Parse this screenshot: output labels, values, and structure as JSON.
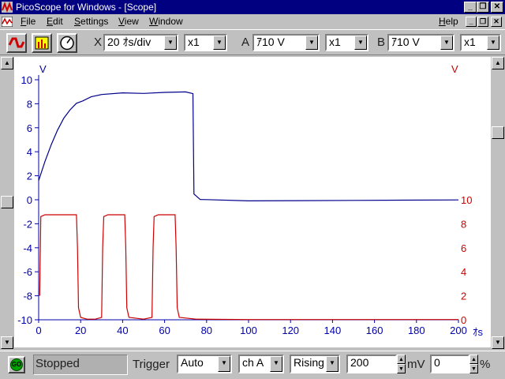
{
  "window": {
    "title": "PicoScope for Windows - [Scope]",
    "minimize": "_",
    "restore": "❐",
    "close": "✕"
  },
  "menu": {
    "items": [
      {
        "underline": "F",
        "rest": "ile"
      },
      {
        "underline": "E",
        "rest": "dit"
      },
      {
        "underline": "S",
        "rest": "ettings"
      },
      {
        "underline": "V",
        "rest": "iew"
      },
      {
        "underline": "W",
        "rest": "indow"
      }
    ],
    "help": {
      "underline": "H",
      "rest": "elp"
    }
  },
  "toolbar": {
    "x_label": "X",
    "timebase": "20 ｵs/div",
    "x_multiplier": "x1",
    "a_label": "A",
    "a_range": "ｱ10 V",
    "a_multiplier": "x1",
    "b_label": "B",
    "b_range": "ｱ10 V",
    "b_multiplier": "x1"
  },
  "icons": {
    "app": "picoscope-icon",
    "signal": "red-waveform-icon",
    "spectrum": "spectrum-icon",
    "meter": "meter-icon"
  },
  "colors": {
    "channel_a": "#00008b",
    "channel_b": "#cc0000",
    "axis": "#0000aa"
  },
  "status": {
    "go": "GO",
    "state": "Stopped",
    "trigger_label": "Trigger",
    "trigger_mode": "Auto",
    "trigger_channel": "ch A",
    "trigger_edge": "Rising",
    "trigger_level": "200",
    "trigger_unit": "mV",
    "delay": "0",
    "delay_unit": "%"
  },
  "chart_data": {
    "type": "line",
    "x_unit": "ｵs",
    "xlim": [
      0,
      200
    ],
    "x_ticks": [
      "0",
      "20",
      "40",
      "60",
      "80",
      "100",
      "120",
      "140",
      "160",
      "180",
      "200"
    ],
    "left_axis": {
      "unit": "V",
      "ylim": [
        -10,
        10
      ],
      "ticks": [
        "10",
        "8",
        "6",
        "4",
        "2",
        "0",
        "-2",
        "-4",
        "-6",
        "-8",
        "-10"
      ]
    },
    "right_axis": {
      "unit": "V",
      "ylim": [
        0,
        10
      ],
      "ticks": [
        "10",
        "8",
        "6",
        "4",
        "2",
        "0"
      ]
    },
    "series": [
      {
        "axis": "left",
        "color": "#00008b",
        "x": [
          0,
          3,
          6,
          9,
          12,
          15,
          18,
          21,
          25,
          30,
          40,
          50,
          60,
          70,
          73.5,
          74,
          77,
          80,
          100,
          150,
          200
        ],
        "y": [
          1.6,
          3.2,
          4.6,
          5.8,
          6.8,
          7.5,
          8.0,
          8.3,
          8.6,
          8.75,
          8.85,
          8.9,
          8.95,
          8.95,
          8.9,
          0.5,
          0.0,
          -0.05,
          -0.05,
          -0.05,
          -0.05
        ]
      },
      {
        "axis": "right",
        "color": "#cc0000",
        "x": [
          0.5,
          1,
          3,
          18,
          18.5,
          19,
          20,
          23,
          27,
          30,
          30.5,
          31,
          33,
          41,
          41.5,
          42,
          43,
          50,
          54,
          54.5,
          55,
          57,
          65,
          65.5,
          66,
          67,
          75,
          100,
          150,
          200
        ],
        "y": [
          2,
          8.6,
          8.75,
          8.75,
          6,
          1,
          0.2,
          0.05,
          0.05,
          0.2,
          6,
          8.6,
          8.75,
          8.75,
          6,
          1,
          0.2,
          0.05,
          0.2,
          6,
          8.6,
          8.75,
          8.75,
          6,
          1,
          0.2,
          0.05,
          0.02,
          0.02,
          0.02
        ]
      }
    ]
  }
}
